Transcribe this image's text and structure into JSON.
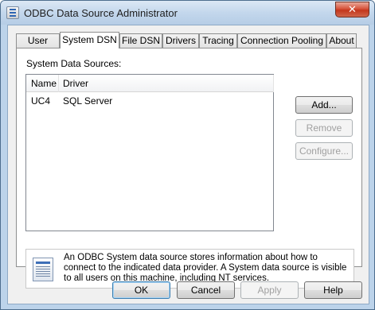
{
  "window": {
    "title": "ODBC Data Source Administrator",
    "close_glyph": "✕"
  },
  "tabs": [
    {
      "label": "User DSN"
    },
    {
      "label": "System DSN"
    },
    {
      "label": "File DSN"
    },
    {
      "label": "Drivers"
    },
    {
      "label": "Tracing"
    },
    {
      "label": "Connection Pooling"
    },
    {
      "label": "About"
    }
  ],
  "active_tab": "System DSN",
  "system_dsn": {
    "list_label": "System Data Sources:",
    "columns": [
      "Name",
      "Driver"
    ],
    "rows": [
      {
        "name": "UC4",
        "driver": "SQL Server"
      }
    ],
    "buttons": {
      "add": "Add...",
      "remove": "Remove",
      "configure": "Configure..."
    },
    "info_text": "An ODBC System data source stores information about how to connect to the indicated data provider.   A System data source is visible to all users on this machine, including NT services."
  },
  "footer": {
    "ok": "OK",
    "cancel": "Cancel",
    "apply": "Apply",
    "help": "Help"
  },
  "colors": {
    "titlebar": "#c3d7ec",
    "close_button": "#c2361d",
    "dialog_face": "#f0f0f0"
  }
}
